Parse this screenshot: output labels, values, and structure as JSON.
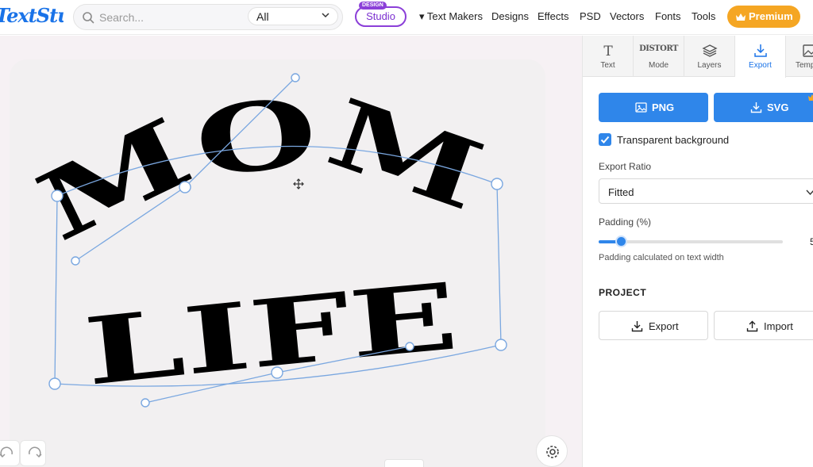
{
  "header": {
    "logo_text": "TextStudio",
    "search": {
      "placeholder": "Search...",
      "value": ""
    },
    "category_select": {
      "selected": "All"
    },
    "studio_button": {
      "tag": "DESIGN",
      "label": "Studio",
      "accent": "#8b3fd8"
    },
    "nav": [
      {
        "label": "▾ Text Makers"
      },
      {
        "label": "Designs"
      },
      {
        "label": "Effects"
      },
      {
        "label": "PSD"
      },
      {
        "label": "Vectors"
      },
      {
        "label": "Fonts"
      },
      {
        "label": "Tools"
      }
    ],
    "premium_button": {
      "label": "Premium",
      "icon": "crown-icon",
      "color": "#f5a623"
    }
  },
  "canvas": {
    "text_lines": [
      "MOM",
      "LIFE"
    ],
    "text_color": "#000000",
    "guide_color": "#7aa7e0",
    "background": "#f2f0f1",
    "controls": {
      "undo_icon": "undo-icon",
      "redo_icon": "redo-icon",
      "settings_icon": "gear-icon"
    }
  },
  "panel": {
    "tabs": [
      {
        "label": "Text",
        "icon": "text-icon",
        "active": false
      },
      {
        "label": "Mode",
        "icon": "distort-icon",
        "icon_text": "DISTORT",
        "active": false
      },
      {
        "label": "Layers",
        "icon": "layers-icon",
        "active": false
      },
      {
        "label": "Export",
        "icon": "download-icon",
        "active": true
      },
      {
        "label": "Temp",
        "icon": "image-icon",
        "active": false
      }
    ],
    "export": {
      "png_button": "PNG",
      "svg_button": "SVG",
      "transparent_background": {
        "label": "Transparent background",
        "checked": true
      },
      "export_ratio": {
        "label": "Export Ratio",
        "selected": "Fitted"
      },
      "padding": {
        "label": "Padding (%)",
        "value": "5",
        "hint": "Padding calculated on text width",
        "fraction": 0.12
      }
    },
    "project": {
      "title": "PROJECT",
      "export_button": "Export",
      "import_button": "Import"
    },
    "accent": "#2f86ea"
  }
}
